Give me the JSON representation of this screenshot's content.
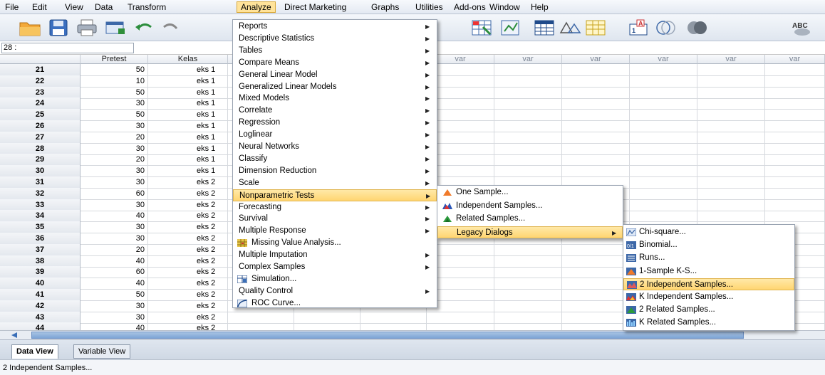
{
  "menubar": [
    "File",
    "Edit",
    "View",
    "Data",
    "Transform",
    "Analyze",
    "Direct Marketing",
    "Graphs",
    "Utilities",
    "Add-ons",
    "Window",
    "Help"
  ],
  "cell_ref": "28 :",
  "columns": [
    "Pretest",
    "Kelas",
    "var",
    "var",
    "var",
    "var",
    "var",
    "var",
    "var",
    "var"
  ],
  "rows": [
    {
      "n": "21",
      "pretest": "50",
      "kelas": "eks 1"
    },
    {
      "n": "22",
      "pretest": "10",
      "kelas": "eks 1"
    },
    {
      "n": "23",
      "pretest": "50",
      "kelas": "eks 1"
    },
    {
      "n": "24",
      "pretest": "30",
      "kelas": "eks 1"
    },
    {
      "n": "25",
      "pretest": "50",
      "kelas": "eks 1"
    },
    {
      "n": "26",
      "pretest": "30",
      "kelas": "eks 1"
    },
    {
      "n": "27",
      "pretest": "20",
      "kelas": "eks 1"
    },
    {
      "n": "28",
      "pretest": "30",
      "kelas": "eks 1"
    },
    {
      "n": "29",
      "pretest": "20",
      "kelas": "eks 1"
    },
    {
      "n": "30",
      "pretest": "30",
      "kelas": "eks 1"
    },
    {
      "n": "31",
      "pretest": "30",
      "kelas": "eks 2"
    },
    {
      "n": "32",
      "pretest": "60",
      "kelas": "eks 2"
    },
    {
      "n": "33",
      "pretest": "30",
      "kelas": "eks 2"
    },
    {
      "n": "34",
      "pretest": "40",
      "kelas": "eks 2"
    },
    {
      "n": "35",
      "pretest": "30",
      "kelas": "eks 2"
    },
    {
      "n": "36",
      "pretest": "30",
      "kelas": "eks 2"
    },
    {
      "n": "37",
      "pretest": "20",
      "kelas": "eks 2"
    },
    {
      "n": "38",
      "pretest": "40",
      "kelas": "eks 2"
    },
    {
      "n": "39",
      "pretest": "60",
      "kelas": "eks 2"
    },
    {
      "n": "40",
      "pretest": "40",
      "kelas": "eks 2"
    },
    {
      "n": "41",
      "pretest": "50",
      "kelas": "eks 2"
    },
    {
      "n": "42",
      "pretest": "30",
      "kelas": "eks 2"
    },
    {
      "n": "43",
      "pretest": "30",
      "kelas": "eks 2"
    },
    {
      "n": "44",
      "pretest": "40",
      "kelas": "eks 2"
    }
  ],
  "analyze_menu": [
    {
      "label": "Reports",
      "sub": true
    },
    {
      "label": "Descriptive Statistics",
      "sub": true
    },
    {
      "label": "Tables",
      "sub": true
    },
    {
      "label": "Compare Means",
      "sub": true
    },
    {
      "label": "General Linear Model",
      "sub": true
    },
    {
      "label": "Generalized Linear Models",
      "sub": true
    },
    {
      "label": "Mixed Models",
      "sub": true
    },
    {
      "label": "Correlate",
      "sub": true
    },
    {
      "label": "Regression",
      "sub": true
    },
    {
      "label": "Loglinear",
      "sub": true
    },
    {
      "label": "Neural Networks",
      "sub": true
    },
    {
      "label": "Classify",
      "sub": true
    },
    {
      "label": "Dimension Reduction",
      "sub": true
    },
    {
      "label": "Scale",
      "sub": true
    },
    {
      "label": "Nonparametric Tests",
      "sub": true,
      "highlight": true
    },
    {
      "label": "Forecasting",
      "sub": true
    },
    {
      "label": "Survival",
      "sub": true
    },
    {
      "label": "Multiple Response",
      "sub": true
    },
    {
      "label": "Missing Value Analysis...",
      "sub": false,
      "icon": "missing-value-icon"
    },
    {
      "label": "Multiple Imputation",
      "sub": true
    },
    {
      "label": "Complex Samples",
      "sub": true
    },
    {
      "label": "Simulation...",
      "sub": false,
      "icon": "simulation-icon"
    },
    {
      "label": "Quality Control",
      "sub": true
    },
    {
      "label": "ROC Curve...",
      "sub": false,
      "icon": "roc-curve-icon"
    }
  ],
  "nonparam_menu": [
    {
      "label": "One Sample...",
      "icon": "one-sample-icon"
    },
    {
      "label": "Independent Samples...",
      "icon": "independent-samples-icon"
    },
    {
      "label": "Related Samples...",
      "icon": "related-samples-icon"
    },
    {
      "label": "Legacy Dialogs",
      "sub": true,
      "highlight": true
    }
  ],
  "legacy_menu": [
    {
      "label": "Chi-square...",
      "icon": "chi-square-icon"
    },
    {
      "label": "Binomial...",
      "icon": "binomial-icon"
    },
    {
      "label": "Runs...",
      "icon": "runs-icon"
    },
    {
      "label": "1-Sample K-S...",
      "icon": "one-sample-ks-icon"
    },
    {
      "label": "2 Independent Samples...",
      "icon": "two-independent-icon",
      "highlight": true
    },
    {
      "label": "K Independent Samples...",
      "icon": "k-independent-icon"
    },
    {
      "label": "2 Related Samples...",
      "icon": "two-related-icon"
    },
    {
      "label": "K Related Samples...",
      "icon": "k-related-icon"
    }
  ],
  "tabs": [
    "Data View",
    "Variable View"
  ],
  "status": "2 Independent Samples...",
  "colors": {
    "highlight": "#ffd571",
    "accent": "#3a6fb8"
  }
}
